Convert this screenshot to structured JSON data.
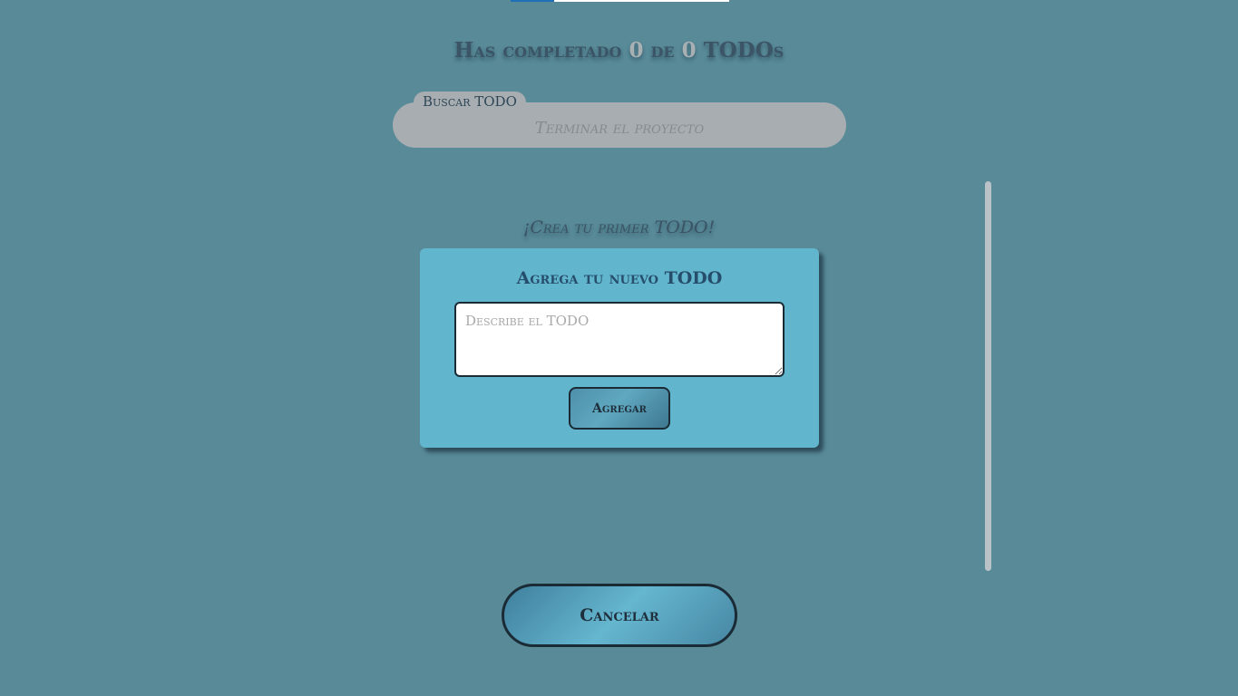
{
  "progress": {
    "completed_fraction": 0.2
  },
  "counter": {
    "prefix": "Has completado",
    "completed": "0",
    "middle": "de",
    "total": "0",
    "suffix": "TODOs"
  },
  "search": {
    "label": "Buscar TODO",
    "placeholder": "Terminar el proyecto",
    "value": ""
  },
  "empty_message": "¡Crea tu primer TODO!",
  "modal": {
    "title": "Agrega tu nuevo TODO",
    "textarea_placeholder": "Describe el TODO",
    "textarea_value": "",
    "add_label": "Agregar"
  },
  "cancel_label": "Cancelar",
  "colors": {
    "background": "#588a98",
    "modal": "#61b5cc",
    "progress_fill": "#1e6fb5",
    "search_bg": "#a7adb0"
  }
}
